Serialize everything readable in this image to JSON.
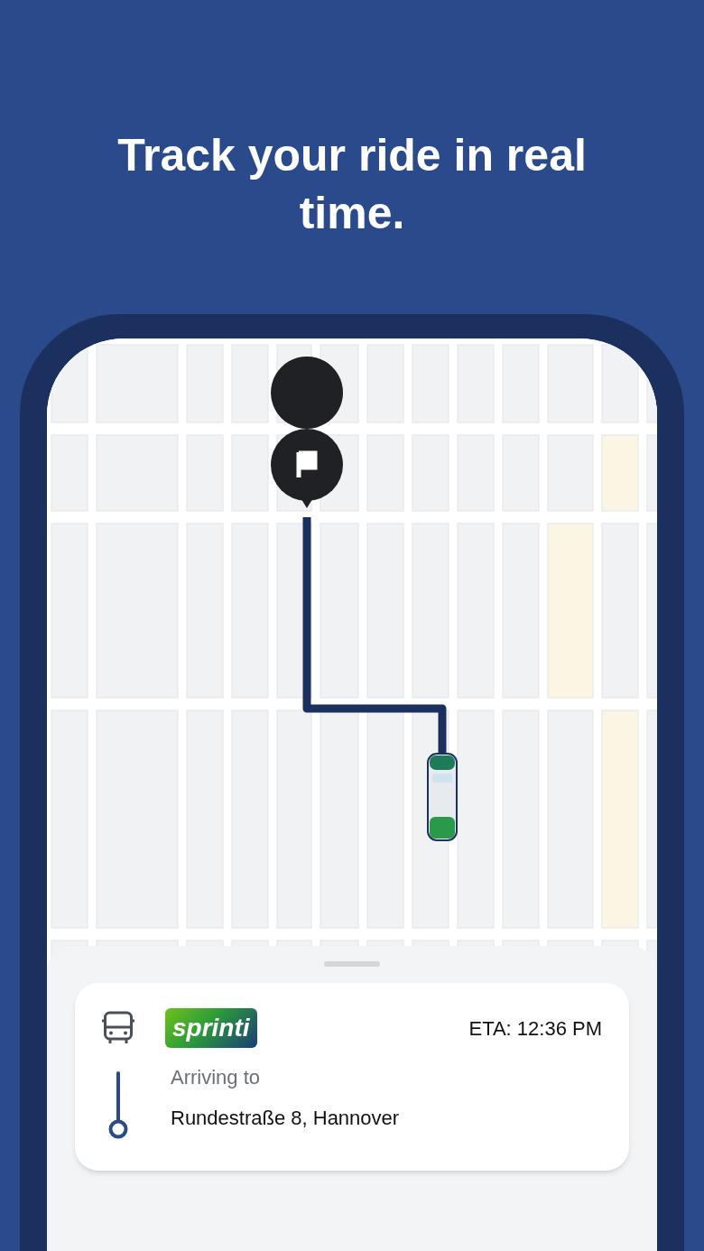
{
  "headline": "Track your ride in real time.",
  "ride_card": {
    "operator_logo": "sprinti",
    "eta": "ETA: 12:36 PM",
    "arriving_label": "Arriving to",
    "address": "Rundestraße 8, Hannover"
  }
}
